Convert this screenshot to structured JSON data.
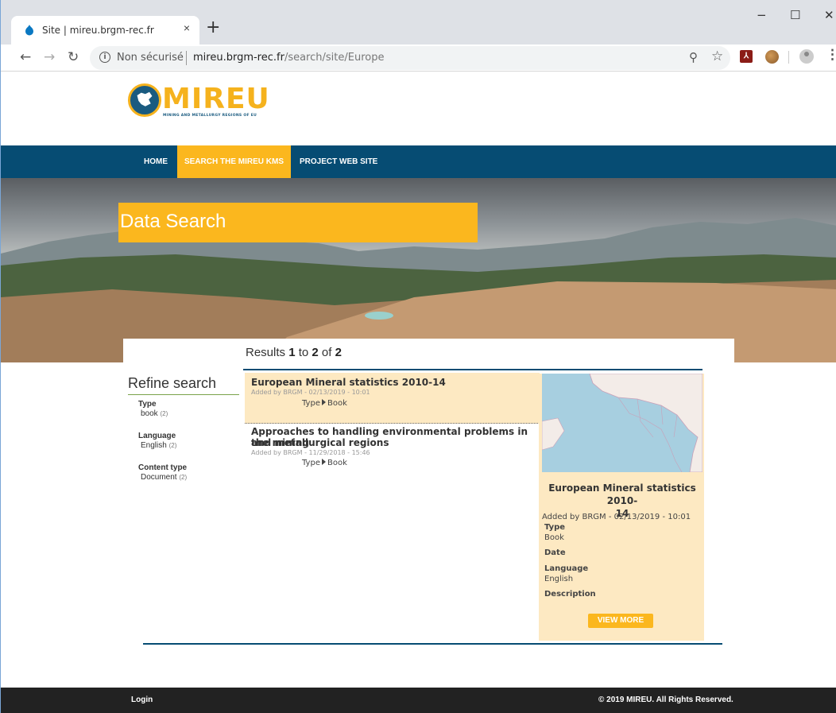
{
  "browser": {
    "tab_title": "Site | mireu.brgm-rec.fr",
    "tab_close": "×",
    "new_tab": "+",
    "security_label": "Non sécurisé",
    "url_host": "mireu.brgm-rec.fr",
    "url_path": "/search/site/Europe",
    "window_controls": {
      "minimize": "−",
      "maximize": "☐",
      "close": "✕"
    }
  },
  "logo": {
    "word": "MIREU",
    "subtitle": "MINING AND METALLURGY REGIONS OF EU"
  },
  "nav": {
    "home": "HOME",
    "search": "SEARCH THE MIREU KMS",
    "project": "PROJECT WEB SITE"
  },
  "hero": {
    "title": "Data Search"
  },
  "results": {
    "prefix": "Results ",
    "from": "1",
    "to_word": " to ",
    "to": "2",
    "of_word": " of ",
    "total": "2"
  },
  "refine": {
    "title": "Refine search",
    "facets": [
      {
        "heading": "Type",
        "value": "book",
        "count": "(2)"
      },
      {
        "heading": "Language",
        "value": "English",
        "count": "(2)"
      },
      {
        "heading": "Content type",
        "value": "Document",
        "count": "(2)"
      }
    ]
  },
  "items": [
    {
      "title": "European Mineral statistics 2010-14",
      "meta": "Added by BRGM - 02/13/2019 - 10:01",
      "type_label": "Type",
      "type_value": "Book"
    },
    {
      "title_line1": "Approaches to handling environmental problems in the mining",
      "title_line2": "and metallurgical regions",
      "meta": "Added by BRGM - 11/29/2018 - 15:46",
      "type_label": "Type",
      "type_value": "Book"
    }
  ],
  "detail": {
    "title_line1": "European Mineral statistics 2010-",
    "title_line2": "14",
    "meta": "Added by BRGM - 02/13/2019 - 10:01",
    "type_label": "Type",
    "type_value": "Book",
    "date_label": "Date",
    "language_label": "Language",
    "language_value": "English",
    "description_label": "Description",
    "view_more": "VIEW MORE"
  },
  "footer": {
    "login": "Login",
    "copyright": "© 2019 MIREU. All Rights Reserved."
  },
  "colors": {
    "nav_bg": "#064c73",
    "accent": "#fbb71e",
    "highlight_bg": "#fde9c2",
    "footer_bg": "#222222"
  }
}
